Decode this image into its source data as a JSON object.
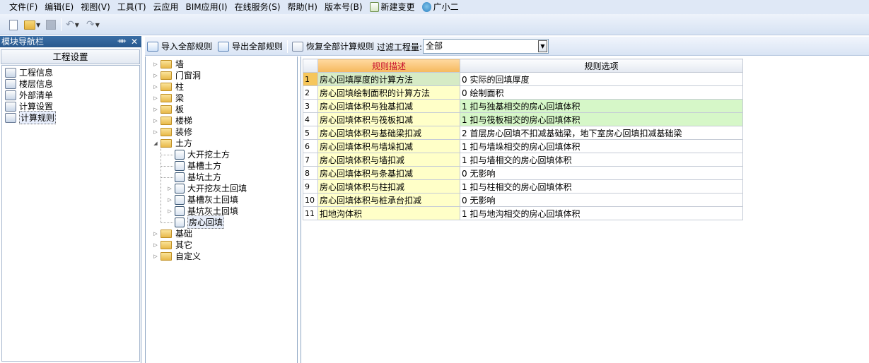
{
  "menubar": {
    "items": [
      "文件(F)",
      "编辑(E)",
      "视图(V)",
      "工具(T)",
      "云应用",
      "BIM应用(I)",
      "在线服务(S)",
      "帮助(H)",
      "版本号(B)"
    ],
    "new_change": "新建变更",
    "guangxiaoer": "广小二"
  },
  "toolbar": {
    "icons": [
      "new-file-icon",
      "open-folder-icon",
      "save-icon",
      "undo-icon",
      "redo-icon"
    ]
  },
  "nav": {
    "title": "模块导航栏",
    "pin": "ᚓ",
    "close": "✕",
    "group": "工程设置",
    "items": [
      {
        "label": "工程信息",
        "icon": "project-info-icon"
      },
      {
        "label": "楼层信息",
        "icon": "floor-info-icon"
      },
      {
        "label": "外部清单",
        "icon": "external-list-icon"
      },
      {
        "label": "计算设置",
        "icon": "calc-settings-icon"
      },
      {
        "label": "计算规则",
        "icon": "calc-rules-icon"
      }
    ],
    "selected": "计算规则"
  },
  "rules_toolbar": {
    "import_all": "导入全部规则",
    "export_all": "导出全部规则",
    "restore_all": "恢复全部计算规则",
    "filter_label": "过滤工程量:",
    "filter_value": "全部"
  },
  "tree": {
    "nodes": [
      {
        "label": "墙",
        "type": "folder",
        "expanded": false
      },
      {
        "label": "门窗洞",
        "type": "folder",
        "expanded": false
      },
      {
        "label": "柱",
        "type": "folder",
        "expanded": false
      },
      {
        "label": "梁",
        "type": "folder",
        "expanded": false
      },
      {
        "label": "板",
        "type": "folder",
        "expanded": false
      },
      {
        "label": "楼梯",
        "type": "folder",
        "expanded": false
      },
      {
        "label": "装修",
        "type": "folder",
        "expanded": false
      },
      {
        "label": "土方",
        "type": "folder",
        "expanded": true
      },
      {
        "label": "大开挖土方",
        "type": "child"
      },
      {
        "label": "基槽土方",
        "type": "child"
      },
      {
        "label": "基坑土方",
        "type": "child"
      },
      {
        "label": "大开挖灰土回填",
        "type": "child",
        "expandable": true
      },
      {
        "label": "基槽灰土回填",
        "type": "child",
        "expandable": true
      },
      {
        "label": "基坑灰土回填",
        "type": "child",
        "expandable": true
      },
      {
        "label": "房心回填",
        "type": "child",
        "selected": true
      },
      {
        "label": "基础",
        "type": "folder",
        "expanded": false
      },
      {
        "label": "其它",
        "type": "folder",
        "expanded": false
      },
      {
        "label": "自定义",
        "type": "folder",
        "expanded": false
      }
    ]
  },
  "grid": {
    "headers": {
      "desc": "规则描述",
      "option": "规则选项"
    },
    "rows": [
      {
        "n": "1",
        "desc": "房心回填厚度的计算方法",
        "opt": "0  实际的回填厚度"
      },
      {
        "n": "2",
        "desc": "房心回填绘制面积的计算方法",
        "opt": "0  绘制面积"
      },
      {
        "n": "3",
        "desc": "房心回填体积与独基扣减",
        "opt": "1  扣与独基相交的房心回填体积"
      },
      {
        "n": "4",
        "desc": "房心回填体积与筏板扣减",
        "opt": "1  扣与筏板相交的房心回填体积"
      },
      {
        "n": "5",
        "desc": "房心回填体积与基础梁扣减",
        "opt": "2  首层房心回填不扣减基础梁，地下室房心回填扣减基础梁"
      },
      {
        "n": "6",
        "desc": "房心回填体积与墙垛扣减",
        "opt": "1  扣与墙垛相交的房心回填体积"
      },
      {
        "n": "7",
        "desc": "房心回填体积与墙扣减",
        "opt": "1  扣与墙相交的房心回填体积"
      },
      {
        "n": "8",
        "desc": "房心回填体积与条基扣减",
        "opt": "0  无影响"
      },
      {
        "n": "9",
        "desc": "房心回填体积与柱扣减",
        "opt": "1  扣与柱相交的房心回填体积"
      },
      {
        "n": "10",
        "desc": "房心回填体积与桩承台扣减",
        "opt": "0  无影响"
      },
      {
        "n": "11",
        "desc": "扣地沟体积",
        "opt": "1 扣与地沟相交的房心回填体积"
      }
    ]
  }
}
